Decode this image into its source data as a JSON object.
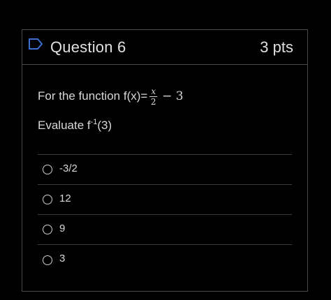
{
  "question": {
    "title": "Question 6",
    "points": "3 pts",
    "prompt_prefix": "For the function f(x)=",
    "fraction_numerator": "x",
    "fraction_denominator": "2",
    "prompt_suffix": "− 3",
    "evaluate_prefix": "Evaluate f",
    "evaluate_superscript": "-1",
    "evaluate_suffix": "(3)"
  },
  "answers": [
    {
      "label": "-3/2"
    },
    {
      "label": "12"
    },
    {
      "label": "9"
    },
    {
      "label": "3"
    }
  ],
  "icons": {
    "flag": "flag-outline-icon",
    "answer_radio": "radio-unchecked-icon"
  },
  "colors": {
    "background": "#000000",
    "text": "#dddddd",
    "border": "#4a4a4a",
    "flag": "#3b6fd1"
  }
}
